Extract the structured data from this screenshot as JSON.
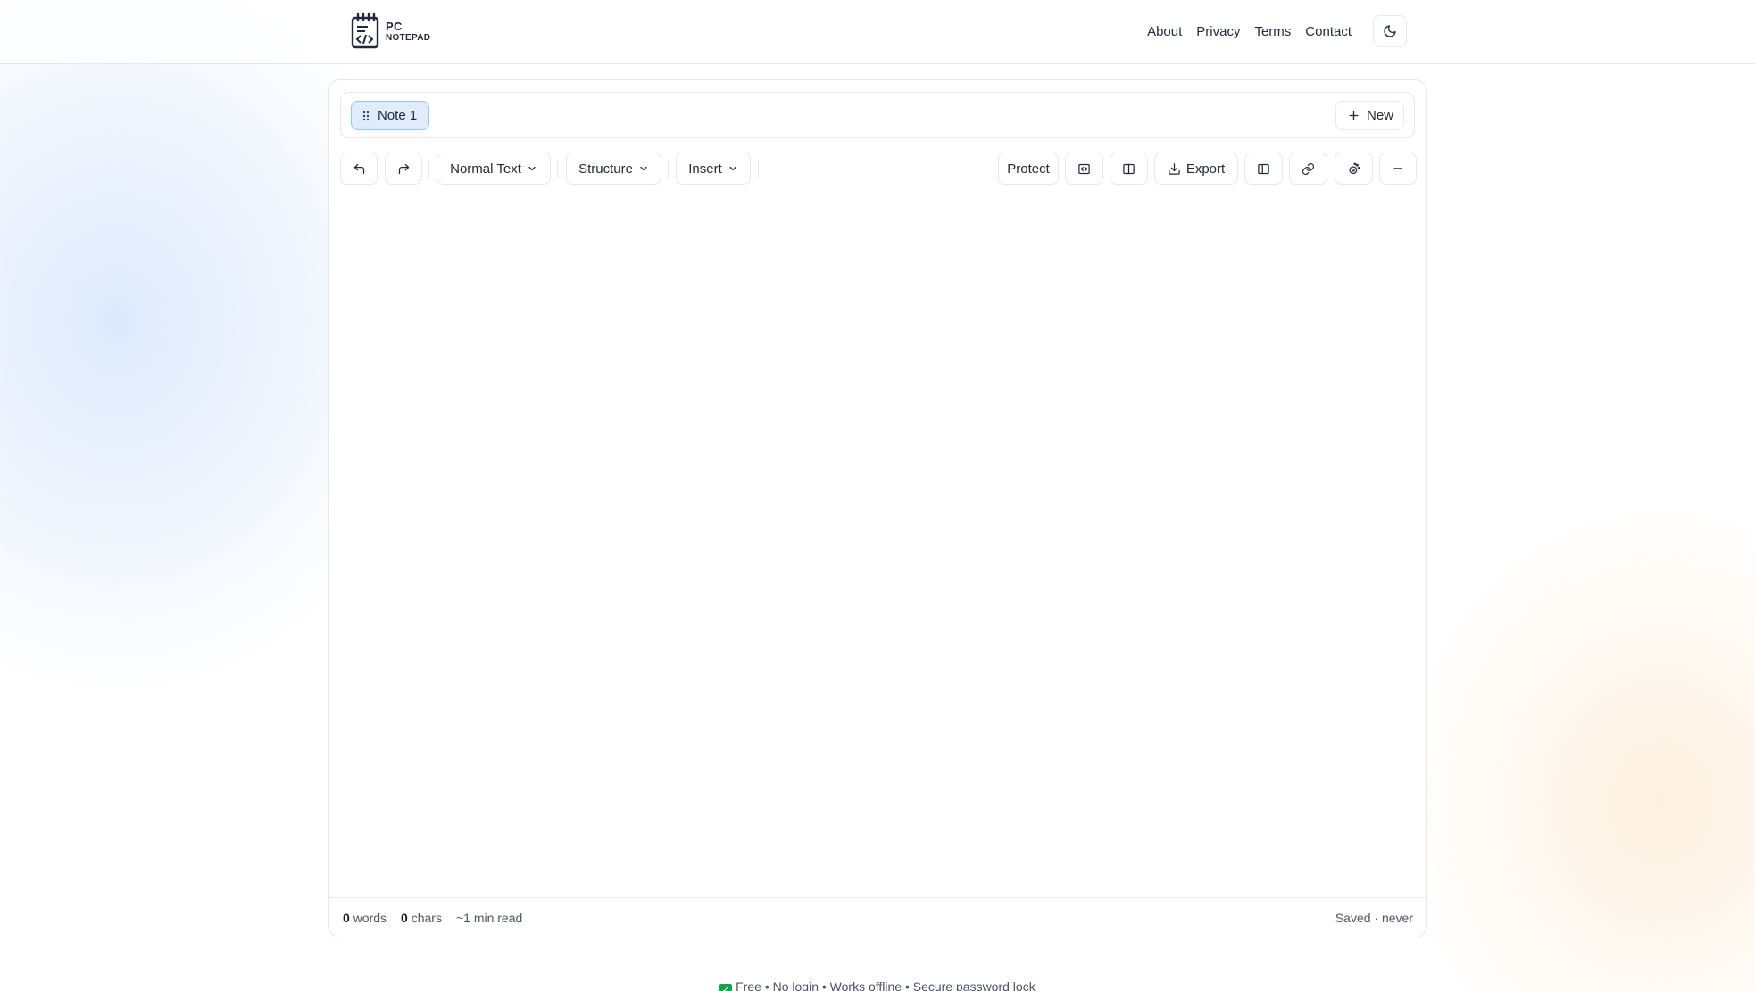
{
  "header": {
    "logo_line1": "PC",
    "logo_line2": "NOTEPAD",
    "nav": [
      "About",
      "Privacy",
      "Terms",
      "Contact"
    ]
  },
  "tabs": {
    "active_label": "Note 1",
    "new_label": "New"
  },
  "toolbar": {
    "format_label": "Normal Text",
    "structure_label": "Structure",
    "insert_label": "Insert",
    "protect_label": "Protect",
    "export_label": "Export",
    "icons": [
      "undo-icon",
      "redo-icon",
      "chevron-down-icon",
      "code-icon",
      "columns-icon",
      "download-icon",
      "split-view-icon",
      "link-icon",
      "theme-palette-icon",
      "minus-icon",
      "moon-icon",
      "grip-icon",
      "plus-icon"
    ]
  },
  "footer": {
    "words_count": "0",
    "words_label": "words",
    "chars_count": "0",
    "chars_label": "chars",
    "read_time": "~1 min read",
    "saved": "Saved · never"
  },
  "tagline": "Free • No login • Works offline • Secure password lock",
  "colors": {
    "tab_bg": "#e0ecfb",
    "tab_border": "#93c5fd",
    "check_green": "#16a34a"
  }
}
